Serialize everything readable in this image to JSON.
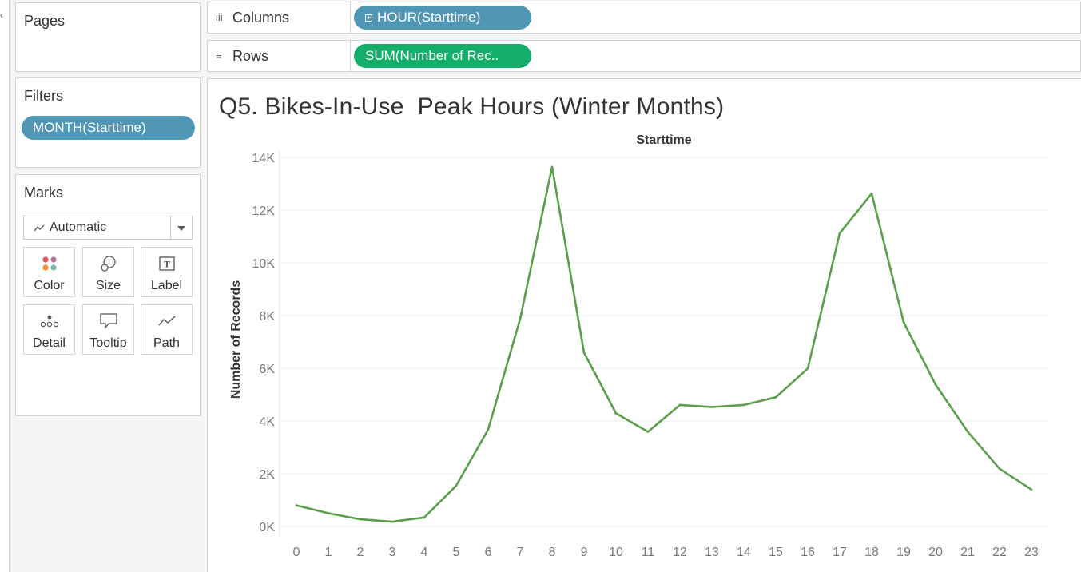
{
  "panels": {
    "pages_title": "Pages",
    "filters_title": "Filters",
    "marks_title": "Marks"
  },
  "filters": [
    {
      "label": "MONTH(Starttime)"
    }
  ],
  "marks": {
    "type_label": "Automatic",
    "buttons": [
      {
        "label": "Color",
        "icon": "color-dots-icon"
      },
      {
        "label": "Size",
        "icon": "size-circles-icon"
      },
      {
        "label": "Label",
        "icon": "text-t-icon"
      },
      {
        "label": "Detail",
        "icon": "detail-dots-icon"
      },
      {
        "label": "Tooltip",
        "icon": "speech-bubble-icon"
      },
      {
        "label": "Path",
        "icon": "path-line-icon"
      }
    ]
  },
  "shelves": {
    "columns_label": "Columns",
    "columns_pill": "HOUR(Starttime)",
    "rows_label": "Rows",
    "rows_pill": "SUM(Number of Rec.."
  },
  "colors": {
    "dimension_pill": "#4f97b5",
    "measure_pill": "#13ae6a",
    "line": "#5a9e4a"
  },
  "chart_data": {
    "type": "line",
    "title": "Q5. Bikes-In-Use  Peak Hours (Winter Months)",
    "xlabel": "Starttime",
    "ylabel": "Number of Records",
    "x": [
      0,
      1,
      2,
      3,
      4,
      5,
      6,
      7,
      8,
      9,
      10,
      11,
      12,
      13,
      14,
      15,
      16,
      17,
      18,
      19,
      20,
      21,
      22,
      23
    ],
    "series": [
      {
        "values": [
          800,
          500,
          270,
          180,
          340,
          1550,
          3680,
          7870,
          13640,
          6590,
          4290,
          3590,
          4610,
          4530,
          4610,
          4900,
          5990,
          11120,
          12630,
          7750,
          5380,
          3600,
          2190,
          1400
        ]
      }
    ],
    "ylim": [
      0,
      14000
    ],
    "yticks": [
      0,
      2000,
      4000,
      6000,
      8000,
      10000,
      12000,
      14000
    ],
    "ytick_labels": [
      "0K",
      "2K",
      "4K",
      "6K",
      "8K",
      "10K",
      "12K",
      "14K"
    ],
    "grid": true
  }
}
